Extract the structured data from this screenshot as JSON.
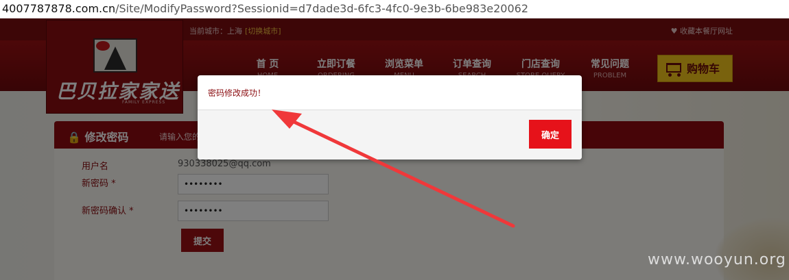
{
  "browser": {
    "url_host": "4007787878.com.cn",
    "url_path": "/Site/ModifyPassword?Sessionid=d7dade3d-6fc3-4fc0-9e3b-6be983e20062"
  },
  "topbar": {
    "city_label": "当前城市：上海",
    "switch_city": "[切换城市]",
    "favorite": "♥ 收藏本餐厅网址"
  },
  "logo": {
    "text": "巴贝拉家家送",
    "sub": "FAMILY EXPRESS"
  },
  "nav": [
    {
      "cn": "首 页",
      "en": "HOME"
    },
    {
      "cn": "立即订餐",
      "en": "ORDERING"
    },
    {
      "cn": "浏览菜单",
      "en": "MENU"
    },
    {
      "cn": "订单查询",
      "en": "SEARCH"
    },
    {
      "cn": "门店查询",
      "en": "STORE QUERY"
    },
    {
      "cn": "常见问题",
      "en": "PROBLEM"
    }
  ],
  "cart": {
    "label": "购物车"
  },
  "panel": {
    "title": "修改密码",
    "hint": "请输入您的"
  },
  "form": {
    "username_label": "用户名",
    "username_value": "930338025@qq.com",
    "new_password_label": "新密码 *",
    "new_password_value": "••••••••",
    "confirm_password_label": "新密码确认 *",
    "confirm_password_value": "••••••••",
    "submit_label": "提交"
  },
  "dialog": {
    "message": "密码修改成功！",
    "ok_label": "确定"
  },
  "watermark": "www.wooyun.org",
  "colors": {
    "brand_red": "#8e0b10",
    "button_red": "#e6121a",
    "cart_yellow": "#f2c41a",
    "annotation_arrow": "#f0383a"
  }
}
